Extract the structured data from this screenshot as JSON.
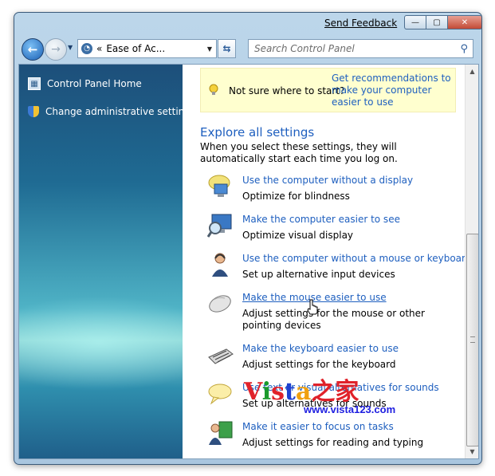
{
  "window": {
    "send_feedback": "Send Feedback",
    "minimize_glyph": "—",
    "maximize_glyph": "▢",
    "close_glyph": "✕"
  },
  "nav": {
    "back_glyph": "←",
    "forward_glyph": "→",
    "address_prefix": "«",
    "address_text": "Ease of Ac...",
    "search_placeholder": "Search Control Panel"
  },
  "sidebar": {
    "items": [
      {
        "label": "Control Panel Home",
        "icon": "control-panel-icon"
      },
      {
        "label": "Change administrative settings",
        "icon": "shield-icon"
      }
    ]
  },
  "tip": {
    "text": "Not sure where to start?",
    "link": "Get recommendations to make your computer easier to use"
  },
  "explore": {
    "heading": "Explore all settings",
    "intro": "When you select these settings, they will automatically start each time you log on."
  },
  "tasks": [
    {
      "link": "Use the computer without a display",
      "desc": "Optimize for blindness",
      "icon": "monitor-speech-icon"
    },
    {
      "link": "Make the computer easier to see",
      "desc": "Optimize visual display",
      "icon": "magnifier-monitor-icon"
    },
    {
      "link": "Use the computer without a mouse or keyboard",
      "desc": "Set up alternative input devices",
      "icon": "person-headset-icon"
    },
    {
      "link": "Make the mouse easier to use",
      "desc": "Adjust settings for the mouse or other pointing devices",
      "icon": "mouse-icon"
    },
    {
      "link": "Make the keyboard easier to use",
      "desc": "Adjust settings for the keyboard",
      "icon": "keyboard-icon"
    },
    {
      "link": "Use text or visual alternatives for sounds",
      "desc": "Set up alternatives for sounds",
      "icon": "speech-bubble-icon"
    },
    {
      "link": "Make it easier to focus on tasks",
      "desc": "Adjust settings for reading and typing",
      "icon": "person-board-icon"
    }
  ],
  "watermark": {
    "brand_v": "V",
    "brand_i": "i",
    "brand_s": "s",
    "brand_t": "t",
    "brand_a": "a",
    "brand_cjk": "之家",
    "url": "www.vista123.com"
  },
  "colors": {
    "link": "#1e5fbf",
    "tip_bg": "#ffffcf",
    "sidebar_top": "#1d4f7a",
    "sidebar_glow": "#8fd8d8"
  }
}
